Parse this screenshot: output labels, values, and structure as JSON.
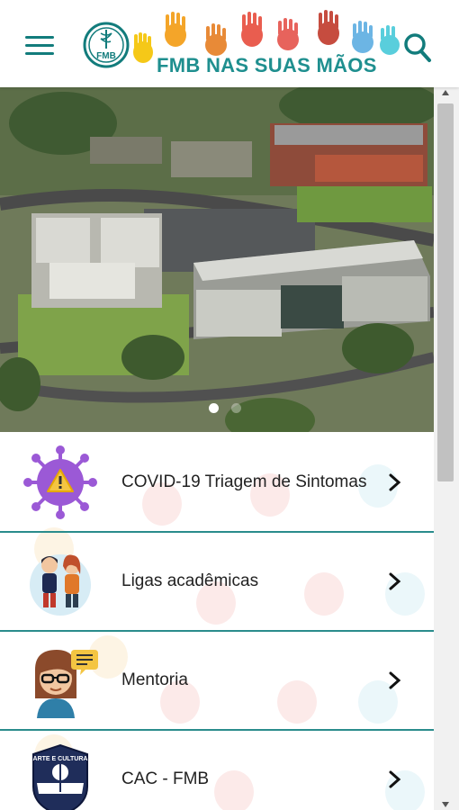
{
  "header": {
    "title": "FMB NAS SUAS MÃOS",
    "logo_text": "FMB",
    "menu_icon": "hamburger-menu-icon",
    "search_icon": "search-icon",
    "accent_color": "#127c7c"
  },
  "carousel": {
    "slide_count": 2,
    "active_slide": 1
  },
  "menu_items": [
    {
      "label": "COVID-19 Triagem de Sintomas",
      "icon": "virus-warning-icon"
    },
    {
      "label": "Ligas acadêmicas",
      "icon": "students-icon"
    },
    {
      "label": "Mentoria",
      "icon": "mentor-chat-icon"
    },
    {
      "label": "CAC - FMB",
      "icon": "cac-shield-icon"
    }
  ],
  "cac_badge_text": "ARTE E CULTURA",
  "colors": {
    "divider": "#2a8c8c",
    "virus": "#9b59d6"
  }
}
